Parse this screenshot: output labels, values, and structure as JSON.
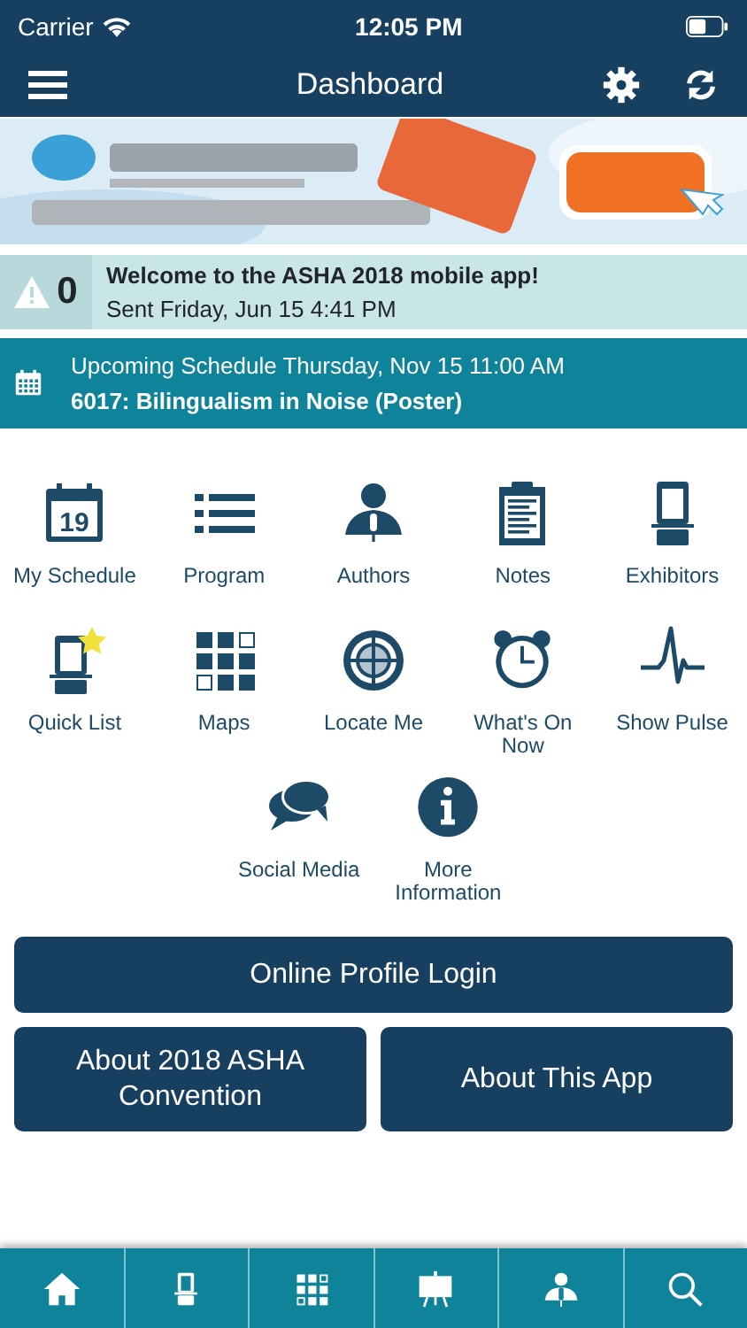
{
  "status_bar": {
    "carrier": "Carrier",
    "time": "12:05 PM"
  },
  "header": {
    "title": "Dashboard"
  },
  "notice": {
    "count": "0",
    "title": "Welcome to the ASHA 2018 mobile app!",
    "sent": "Sent Friday, Jun 15 4:41 PM"
  },
  "upcoming": {
    "heading": "Upcoming Schedule Thursday, Nov 15 11:00 AM",
    "session": "6017: Bilingualism in Noise (Poster)"
  },
  "tiles": [
    {
      "label": "My Schedule",
      "icon_text": "19"
    },
    {
      "label": "Program"
    },
    {
      "label": "Authors"
    },
    {
      "label": "Notes"
    },
    {
      "label": "Exhibitors"
    },
    {
      "label": "Quick List"
    },
    {
      "label": "Maps"
    },
    {
      "label": "Locate Me"
    },
    {
      "label": "What's On Now"
    },
    {
      "label": "Show Pulse"
    },
    {
      "label": "Social Media"
    },
    {
      "label": "More Information"
    }
  ],
  "buttons": [
    {
      "label": "Online Profile Login"
    },
    {
      "label": "About 2018 ASHA Convention"
    },
    {
      "label": "About This App"
    }
  ]
}
